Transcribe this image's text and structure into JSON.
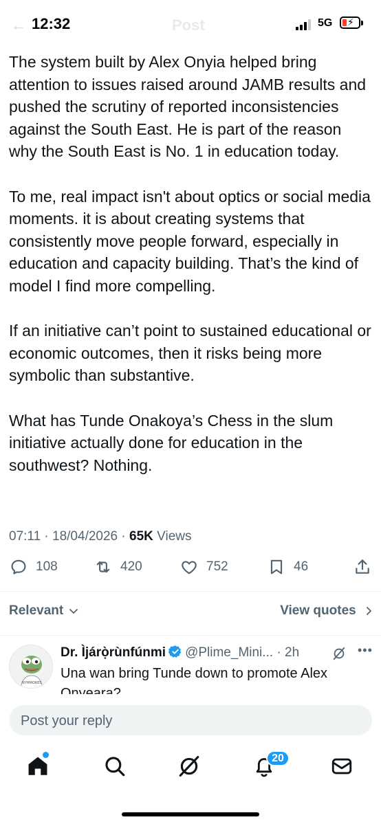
{
  "status_bar": {
    "time": "12:32",
    "network": "5G",
    "faded_back": "←",
    "faded_title": "Post",
    "battery_color": "#ff3b30"
  },
  "tweet": {
    "paragraphs": [
      "The system built by Alex Onyia helped bring attention to issues raised around JAMB results and pushed the scrutiny of reported inconsistencies against the South East. He is part of the reason why the South East is No. 1 in education today.",
      "To me, real impact isn't about optics or social media moments. it is about creating systems that consistently move people forward, especially in education and capacity building. That’s the kind of model I find more compelling.",
      "If an initiative can’t point to sustained educational or economic outcomes, then it risks being more symbolic than substantive.",
      "What has Tunde Onakoya’s Chess in the slum initiative actually done for education in the southwest? Nothing."
    ],
    "timestamp": "07:11 · 18/04/2026 · ",
    "views_count": "65K",
    "views_label": " Views"
  },
  "actions": {
    "replies": "108",
    "reposts": "420",
    "likes": "752",
    "bookmarks": "46"
  },
  "filters": {
    "sort_label": "Relevant",
    "view_quotes": "View quotes"
  },
  "reply": {
    "name": "Dr. Ìjárọ̀rùnfúnmi",
    "handle": "@Plime_Mini...",
    "time": " · 2h",
    "text": "Una wan bring Tunde down to promote Alex Onyeara?",
    "avatar_label": "NYMMORES"
  },
  "compose": {
    "placeholder": "Post your reply"
  },
  "tabbar": {
    "notifications_count": "20",
    "accent": "#1d9bf0"
  },
  "icons": [
    "reply-icon",
    "repost-icon",
    "like-icon",
    "bookmark-icon",
    "share-icon",
    "chevron-down-icon",
    "chevron-right-icon",
    "verified-icon",
    "grok-icon",
    "more-icon",
    "home-icon",
    "search-icon",
    "notifications-icon",
    "messages-icon"
  ]
}
